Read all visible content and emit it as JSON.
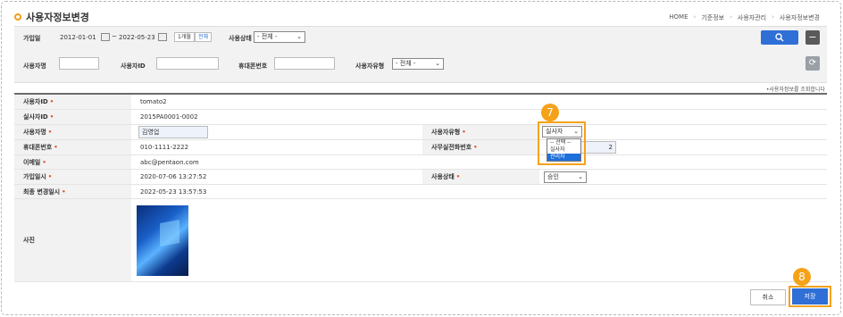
{
  "page": {
    "title": "사용자정보변경"
  },
  "breadcrumb": [
    "HOME",
    "기준정보",
    "사용자관리",
    "사용자정보변경"
  ],
  "search": {
    "join_label": "가입일",
    "date_from": "2012-01-01",
    "date_to": "2022-05-23",
    "btn_1month": "1개월",
    "btn_all": "전체",
    "status_label": "사용상태",
    "status_value": "- 전체 -",
    "name_label": "사용자명",
    "id_label": "사용자ID",
    "phone_label": "휴대폰번호",
    "type_label": "사용자유형",
    "type_value": "- 전체 -"
  },
  "note": "•사용자정보를 조회합니다",
  "detail": {
    "user_id_label": "사용자ID",
    "user_id": "tomato2",
    "real_id_label": "실사자ID",
    "real_id": "2015PA0001-0002",
    "name_label": "사용자명",
    "name": "김영업",
    "type_label": "사용자유형",
    "type_value": "실사자",
    "type_options": [
      "-- 선택 --",
      "실사자",
      "관리자"
    ],
    "phone_label": "휴대폰번호",
    "phone": "010-1111-2222",
    "office_label": "사무실전화번호",
    "office_tail": "2",
    "email_label": "이메일",
    "email": "abc@pentaon.com",
    "joined_label": "가입일시",
    "joined": "2020-07-06 13:27:52",
    "status_label": "사용상태",
    "status_value": "승인",
    "modified_label": "최종 변경일시",
    "modified": "2022-05-23 13:57:53",
    "photo_label": "사진"
  },
  "buttons": {
    "cancel": "취소",
    "save": "저장"
  },
  "badges": {
    "b7": "7",
    "b8": "8"
  },
  "colors": {
    "accent": "#f5a21b",
    "primary": "#2f6fd6"
  }
}
